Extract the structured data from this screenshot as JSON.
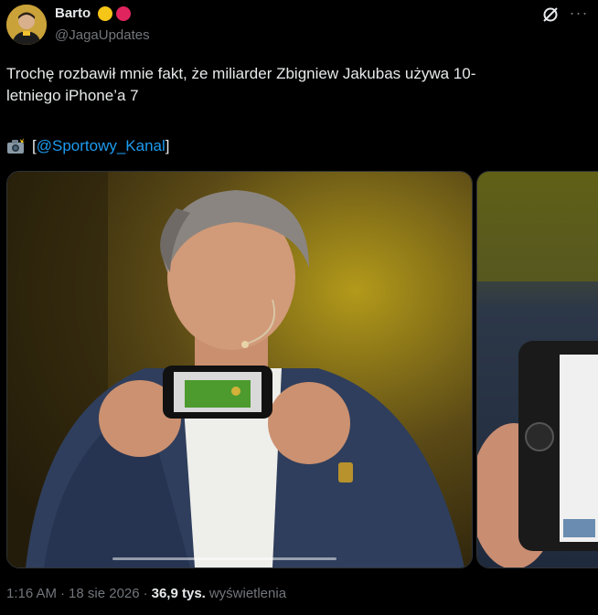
{
  "author": {
    "display_name": "Barto",
    "handle": "@JagaUpdates",
    "badge_colors": [
      "#f5c518",
      "#e0245e"
    ]
  },
  "header_actions": {
    "grok_icon": "grok-slash-icon",
    "more_icon": "more-horizontal-icon",
    "more_label": "···"
  },
  "tweet": {
    "text": "Trochę rozbawił mnie fakt, że miliarder Zbigniew Jakubas używa 10-\nletniego iPhone’a 7",
    "credit_icon": "camera-flash-emoji",
    "credit_open": "[",
    "credit_mention": "@Sportowy_Kanal",
    "credit_close": "]"
  },
  "media": [
    {
      "description_icon": "photo-man-holding-phone"
    },
    {
      "description_icon": "photo-closeup-phone"
    }
  ],
  "meta": {
    "time": "1:16 AM",
    "dot1": "·",
    "date": "18 sie 2026",
    "dot2": "·",
    "views_count": "36,9 tys.",
    "views_label": "wyświetlenia"
  },
  "colors": {
    "background": "#000000",
    "text": "#e7e9ea",
    "muted": "#71767b",
    "link": "#1d9bf0"
  }
}
